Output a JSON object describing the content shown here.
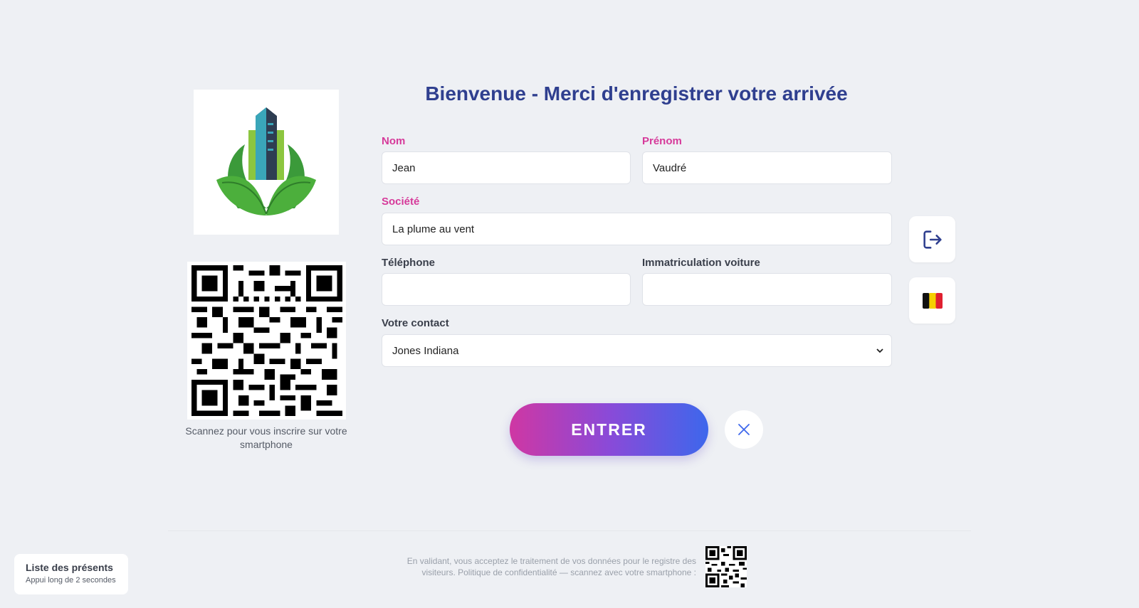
{
  "title": "Bienvenue - Merci d'enregistrer votre arrivée",
  "qr": {
    "caption": "Scannez pour vous inscrire sur votre smartphone"
  },
  "form": {
    "nom": {
      "label": "Nom",
      "value": "Jean"
    },
    "prenom": {
      "label": "Prénom",
      "value": "Vaudré"
    },
    "societe": {
      "label": "Société",
      "value": "La plume au vent"
    },
    "telephone": {
      "label": "Téléphone",
      "value": ""
    },
    "immatriculation": {
      "label": "Immatriculation voiture",
      "value": ""
    },
    "contact": {
      "label": "Votre contact",
      "value": "Jones Indiana"
    }
  },
  "buttons": {
    "enter_label": "ENTRER"
  },
  "side": {
    "exit_icon": "logout-icon",
    "language_icon": "belgium-flag-icon"
  },
  "footer": {
    "consent_text": "En validant, vous acceptez le traitement de vos données pour le registre des visiteurs. Politique de confidentialité — scannez avec votre smartphone :"
  },
  "presence": {
    "title": "Liste des présents",
    "subtitle": "Appui long de 2 secondes"
  },
  "colors": {
    "title": "#2f3f8f",
    "required_label": "#d63a9a",
    "button_gradient_start": "#cf37a3",
    "button_gradient_end": "#3d67ec",
    "background": "#eef0f4"
  }
}
